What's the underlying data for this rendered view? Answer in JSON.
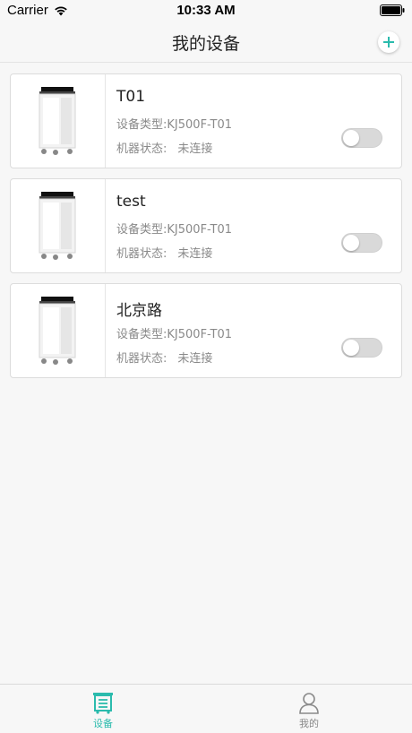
{
  "status_bar": {
    "carrier": "Carrier",
    "time": "10:33 AM"
  },
  "nav": {
    "title": "我的设备",
    "add_icon": "plus-icon",
    "accent": "#2bbbad"
  },
  "devices": [
    {
      "name": "T01",
      "type_label": "设备类型:",
      "type_value": "KJ500F-T01",
      "state_label": "机器状态:",
      "state_value": "未连接",
      "power_on": false
    },
    {
      "name": "test",
      "type_label": "设备类型:",
      "type_value": "KJ500F-T01",
      "state_label": "机器状态:",
      "state_value": "未连接",
      "power_on": false
    },
    {
      "name": "北京路",
      "type_label": "设备类型:",
      "type_value": "KJ500F-T01",
      "state_label": "机器状态:",
      "state_value": "未连接",
      "power_on": false
    }
  ],
  "tabs": [
    {
      "label": "设备",
      "icon": "device-tab-icon",
      "active": true
    },
    {
      "label": "我的",
      "icon": "profile-tab-icon",
      "active": false
    }
  ]
}
